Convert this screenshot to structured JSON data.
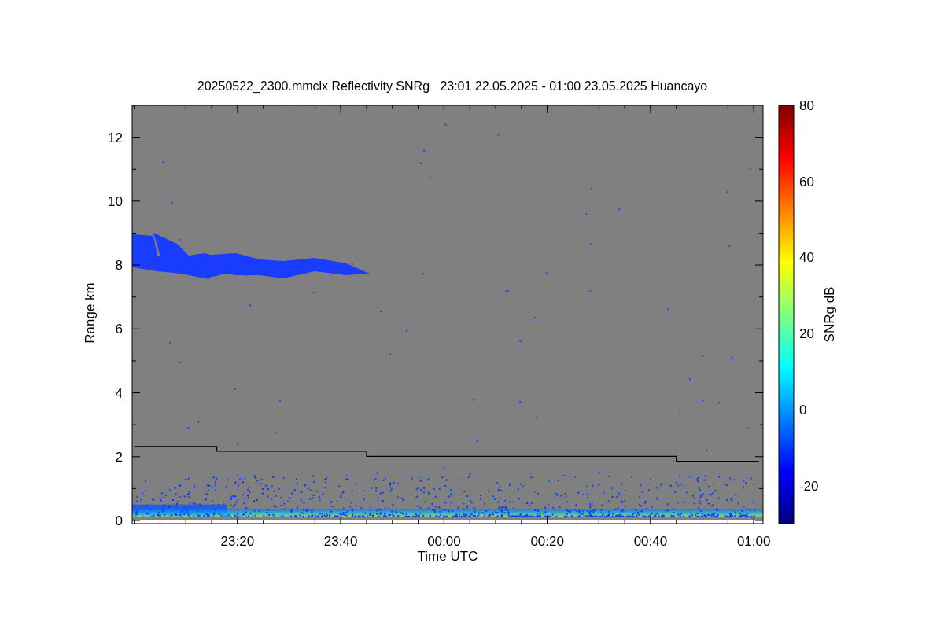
{
  "figure": {
    "title": "20250522_2300.mmclx Reflectivity SNRg   23:01 22.05.2025 - 01:00 23.05.2025 Huancayo",
    "x_axis": {
      "label": "Time UTC",
      "ticks": [
        "23:20",
        "23:40",
        "00:00",
        "00:20",
        "00:40",
        "01:00"
      ]
    },
    "y_axis": {
      "label": "Range km",
      "ticks": [
        "12",
        "10",
        "8",
        "6",
        "4",
        "2",
        "0"
      ]
    },
    "colorbar": {
      "label": "SNRg dB",
      "ticks": [
        "80",
        "60",
        "40",
        "20",
        "0",
        "-20"
      ]
    }
  }
}
